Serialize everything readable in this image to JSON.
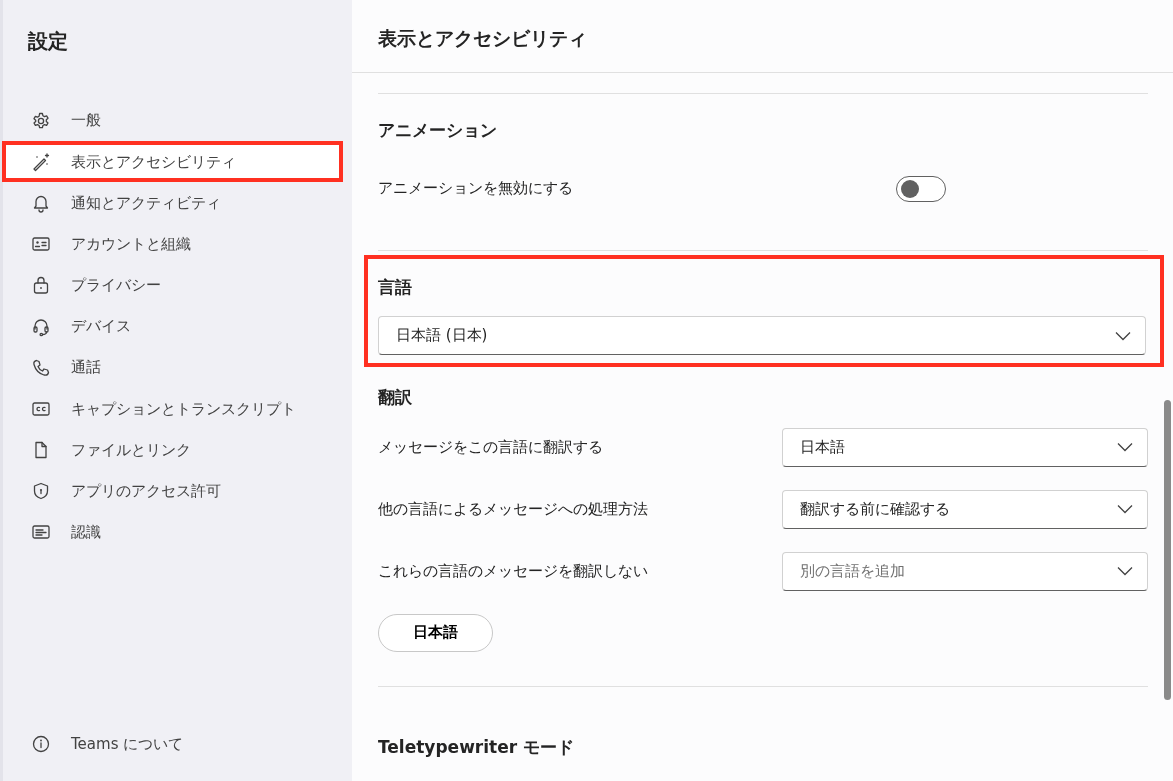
{
  "sidebar": {
    "title": "設定",
    "items": [
      {
        "label": "一般",
        "selected": false,
        "highlighted": false
      },
      {
        "label": "表示とアクセシビリティ",
        "selected": true,
        "highlighted": true
      },
      {
        "label": "通知とアクティビティ",
        "selected": false,
        "highlighted": false
      },
      {
        "label": "アカウントと組織",
        "selected": false,
        "highlighted": false
      },
      {
        "label": "プライバシー",
        "selected": false,
        "highlighted": false
      },
      {
        "label": "デバイス",
        "selected": false,
        "highlighted": false
      },
      {
        "label": "通話",
        "selected": false,
        "highlighted": false
      },
      {
        "label": "キャプションとトランスクリプト",
        "selected": false,
        "highlighted": false
      },
      {
        "label": "ファイルとリンク",
        "selected": false,
        "highlighted": false
      },
      {
        "label": "アプリのアクセス許可",
        "selected": false,
        "highlighted": false
      },
      {
        "label": "認識",
        "selected": false,
        "highlighted": false
      }
    ],
    "footer": {
      "label": "Teams について"
    }
  },
  "page": {
    "title": "表示とアクセシビリティ",
    "animation": {
      "heading": "アニメーション",
      "toggle_label": "アニメーションを無効にする",
      "on": false
    },
    "language": {
      "heading": "言語",
      "value": "日本語 (日本)",
      "highlighted": true
    },
    "translation": {
      "heading": "翻訳",
      "rows": [
        {
          "label": "メッセージをこの言語に翻訳する",
          "value": "日本語"
        },
        {
          "label": "他の言語によるメッセージへの処理方法",
          "value": "翻訳する前に確認する"
        },
        {
          "label": "これらの言語のメッセージを翻訳しない",
          "placeholder": "別の言語を追加"
        }
      ],
      "chips": [
        "日本語"
      ]
    },
    "next_heading": "Teletypewriter モード"
  }
}
